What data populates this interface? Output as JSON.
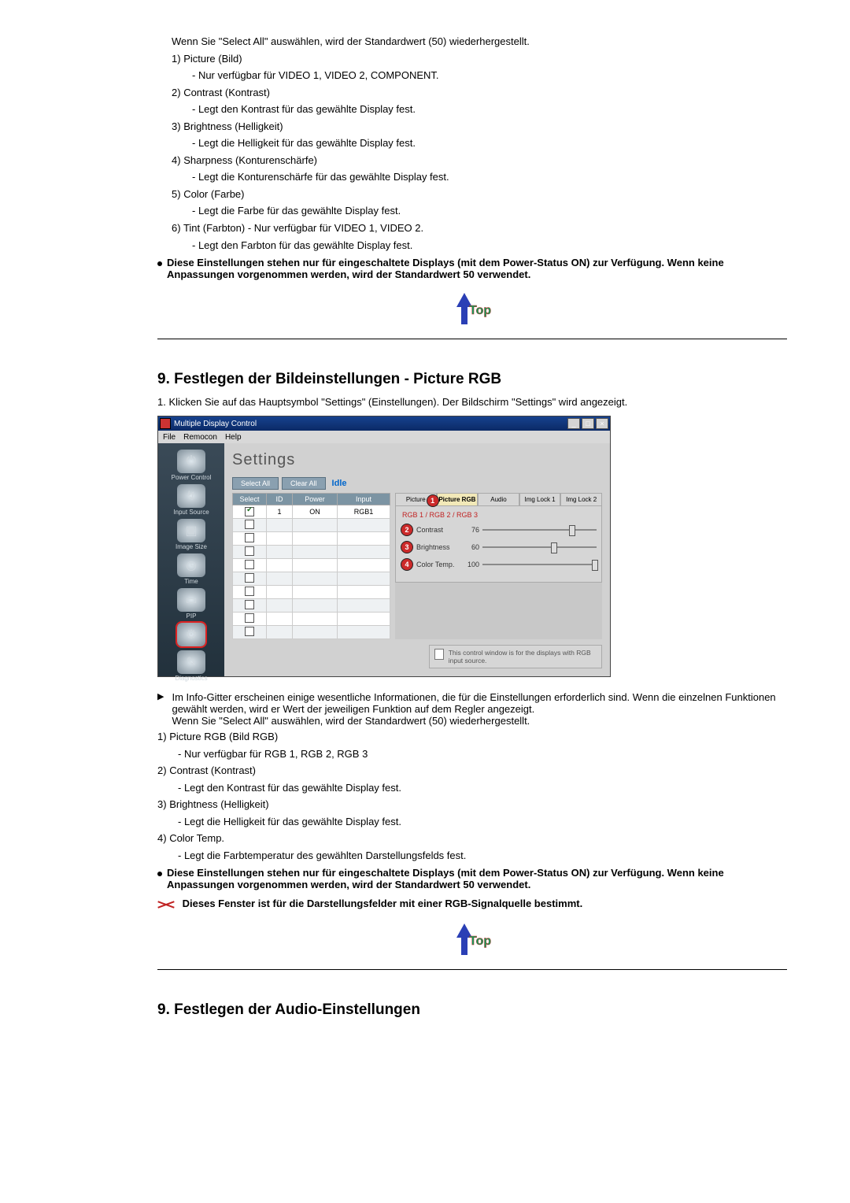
{
  "intro_top_items": {
    "select_all_note": "Wenn Sie \"Select All\" auswählen, wird der Standardwert (50) wiederhergestellt.",
    "list": [
      {
        "num": "1)",
        "title": "Picture (Bild)",
        "sub": "- Nur verfügbar für VIDEO 1, VIDEO 2, COMPONENT."
      },
      {
        "num": "2)",
        "title": "Contrast (Kontrast)",
        "sub": "- Legt den Kontrast für das gewählte Display fest."
      },
      {
        "num": "3)",
        "title": "Brightness (Helligkeit)",
        "sub": "- Legt die Helligkeit für das gewählte Display fest."
      },
      {
        "num": "4)",
        "title": "Sharpness (Konturenschärfe)",
        "sub": "- Legt die Konturenschärfe für das gewählte Display fest."
      },
      {
        "num": "5)",
        "title": "Color (Farbe)",
        "sub": "- Legt die Farbe für das gewählte Display fest."
      },
      {
        "num": "6)",
        "title": "Tint (Farbton)",
        "title_extra": "- Nur verfügbar für VIDEO 1, VIDEO 2.",
        "sub": "- Legt den Farbton für das gewählte Display fest."
      }
    ],
    "bullet_bold": "Diese Einstellungen stehen nur für eingeschaltete Displays (mit dem Power-Status ON) zur Verfügung. Wenn keine Anpassungen vorgenommen werden, wird der Standardwert 50 verwendet."
  },
  "top_label": "Top",
  "section9a": {
    "heading": "9. Festlegen der Bildeinstellungen - Picture RGB",
    "step1": "1. Klicken Sie auf das Hauptsymbol \"Settings\" (Einstellungen). Der Bildschirm \"Settings\" wird angezeigt."
  },
  "mock": {
    "title": "Multiple Display Control",
    "menus": [
      "File",
      "Remocon",
      "Help"
    ],
    "sidebar": [
      {
        "label": "Power Control",
        "glyph": "⏻"
      },
      {
        "label": "Input Source",
        "glyph": "↯"
      },
      {
        "label": "Image Size",
        "glyph": "▣"
      },
      {
        "label": "Time",
        "glyph": "◷"
      },
      {
        "label": "PIP",
        "glyph": "▭"
      },
      {
        "label": "",
        "glyph": "⚙",
        "selected": true
      },
      {
        "label": "Diagnostics",
        "glyph": "✎"
      }
    ],
    "heading": "Settings",
    "buttons": {
      "select_all": "Select All",
      "clear_all": "Clear All",
      "idle": "Idle"
    },
    "grid_headers": [
      "Select",
      "ID",
      "Power",
      "Input"
    ],
    "grid_row": {
      "id": "1",
      "power": "ON",
      "input": "RGB1",
      "checked": true
    },
    "blank_rows": 9,
    "control_tabs": [
      "Picture",
      "Picture RGB",
      "Audio",
      "Img Lock 1",
      "Img Lock 2"
    ],
    "active_tab": "Picture RGB",
    "mode_line": "RGB 1 / RGB 2 / RGB 3",
    "sliders": [
      {
        "badge": "2",
        "label": "Contrast",
        "value": "76",
        "pos": 76
      },
      {
        "badge": "3",
        "label": "Brightness",
        "value": "60",
        "pos": 60
      },
      {
        "badge": "4",
        "label": "Color Temp.",
        "value": "100",
        "pos": 100
      }
    ],
    "badge1_pos_text": "1",
    "note": "This control window is for the displays with RGB input source."
  },
  "after_mock": {
    "lead": "Im Info-Gitter erscheinen einige wesentliche Informationen, die für die Einstellungen erforderlich sind. Wenn die einzelnen Funktionen gewählt werden, wird er Wert der jeweiligen Funktion auf dem Regler angezeigt.",
    "lead2": "Wenn Sie \"Select All\" auswählen, wird der Standardwert (50) wiederhergestellt.",
    "list": [
      {
        "num": "1)",
        "title": "Picture RGB (Bild RGB)",
        "sub": "- Nur verfügbar für RGB 1, RGB 2, RGB 3"
      },
      {
        "num": "2)",
        "title": "Contrast (Kontrast)",
        "sub": "- Legt den Kontrast für das gewählte Display fest."
      },
      {
        "num": "3)",
        "title": "Brightness (Helligkeit)",
        "sub": "- Legt die Helligkeit für das gewählte Display fest."
      },
      {
        "num": "4)",
        "title": "Color Temp.",
        "sub": "- Legt die Farbtemperatur des gewählten Darstellungsfelds fest."
      }
    ],
    "bullet_bold": "Diese Einstellungen stehen nur für eingeschaltete Displays (mit dem Power-Status ON) zur Verfügung. Wenn keine Anpassungen vorgenommen werden, wird der Standardwert 50 verwendet.",
    "x_note": "Dieses Fenster ist für die Darstellungsfelder mit einer RGB-Signalquelle bestimmt."
  },
  "section9b": {
    "heading": "9. Festlegen der Audio-Einstellungen"
  }
}
